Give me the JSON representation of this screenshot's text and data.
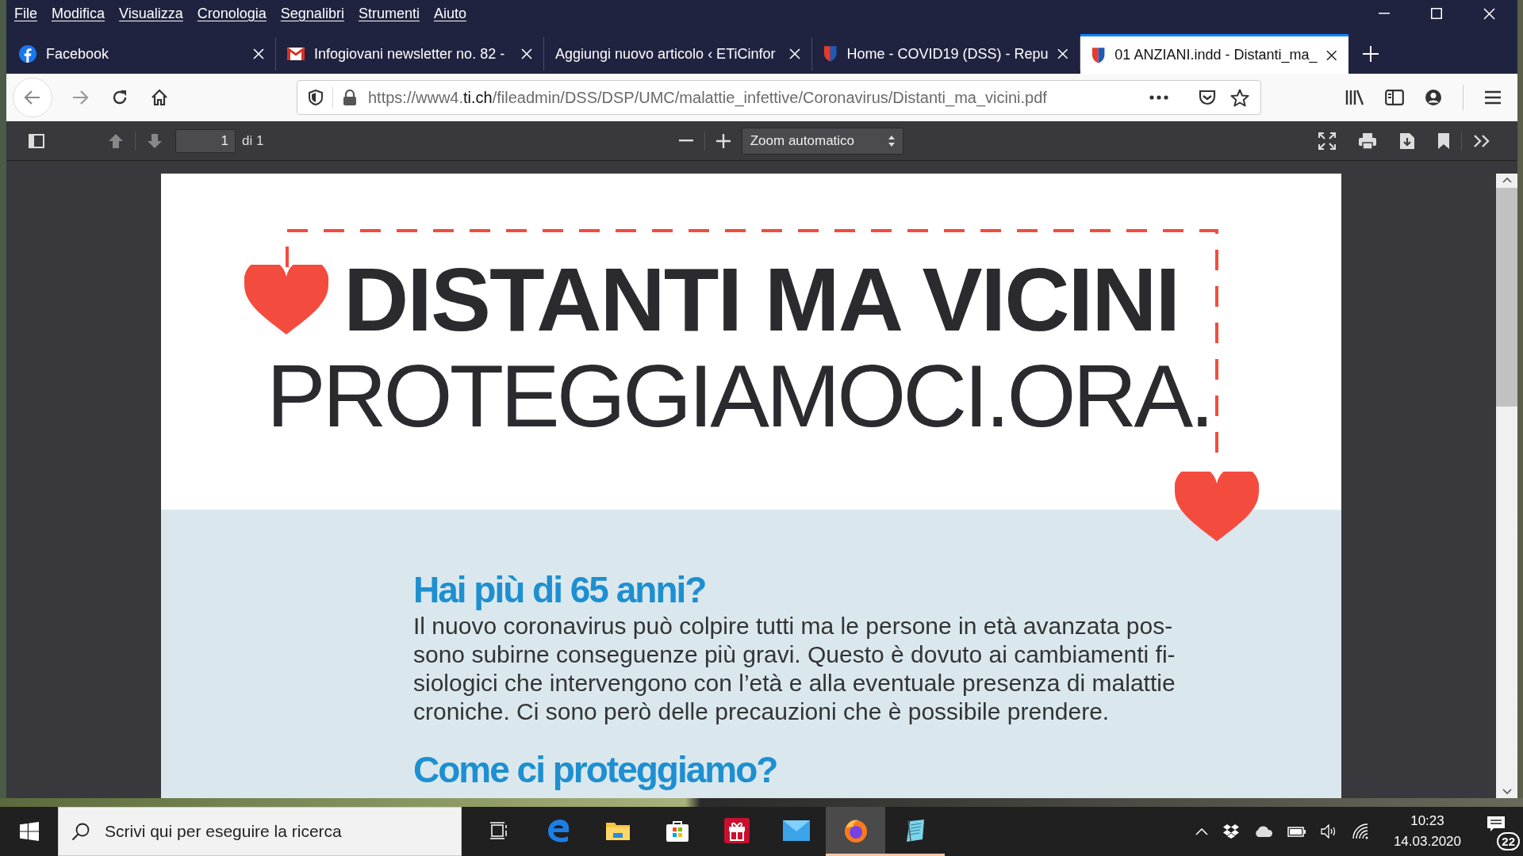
{
  "menu": [
    "File",
    "Modifica",
    "Visualizza",
    "Cronologia",
    "Segnalibri",
    "Strumenti",
    "Aiuto"
  ],
  "tabs": [
    {
      "title": "Facebook",
      "kind": "facebook",
      "selected": false
    },
    {
      "title": "Infogiovani newsletter no. 82 -",
      "kind": "mail",
      "selected": false
    },
    {
      "title": "Aggiungi nuovo articolo ‹ ETiCinfor",
      "kind": "plain",
      "selected": false
    },
    {
      "title": "Home - COVID19 (DSS) - Repu",
      "kind": "crest",
      "selected": false
    },
    {
      "title": "01 ANZIANI.indd - Distanti_ma_",
      "kind": "crest",
      "selected": true
    }
  ],
  "address_bar": {
    "scheme": "https://www4.",
    "domain": "ti.ch",
    "path": "/fileadmin/DSS/DSP/UMC/malattie_infettive/Coronavirus/Distanti_ma_vicini.pdf"
  },
  "pdf_toolbar": {
    "page": "1",
    "page_count": "di 1",
    "zoom": "Zoom automatico"
  },
  "document": {
    "title": "DISTANTI MA VICINI",
    "subtitle": "PROTEGGIAMOCI.ORA.",
    "sections": [
      {
        "heading": "Hai più di 65 anni?",
        "body": "Il nuovo coronavirus può colpire tutti ma le persone in età avanzata pos-\nsono subirne conseguenze più gravi. Questo è dovuto ai cambiamenti fi-\nsiologici che intervengono con l’età e alla eventuale presenza di malattie\ncroniche. Ci sono però delle precauzioni che è possibile prendere."
      },
      {
        "heading": "Come ci proteggiamo?"
      }
    ]
  },
  "taskbar": {
    "search": {
      "placeholder": "Scrivi qui per eseguire la ricerca"
    },
    "apps": [
      {
        "kind": "taskview",
        "running": false,
        "active": false
      },
      {
        "kind": "edge",
        "running": false,
        "active": false
      },
      {
        "kind": "explorer",
        "running": false,
        "active": false
      },
      {
        "kind": "store",
        "running": false,
        "active": false
      },
      {
        "kind": "gift",
        "running": false,
        "active": false
      },
      {
        "kind": "mail",
        "running": false,
        "active": false
      },
      {
        "kind": "firefox",
        "running": true,
        "active": true
      },
      {
        "kind": "notepad",
        "running": true,
        "active": false
      }
    ],
    "time": "10:23",
    "date": "14.03.2020",
    "notifications": "22"
  }
}
